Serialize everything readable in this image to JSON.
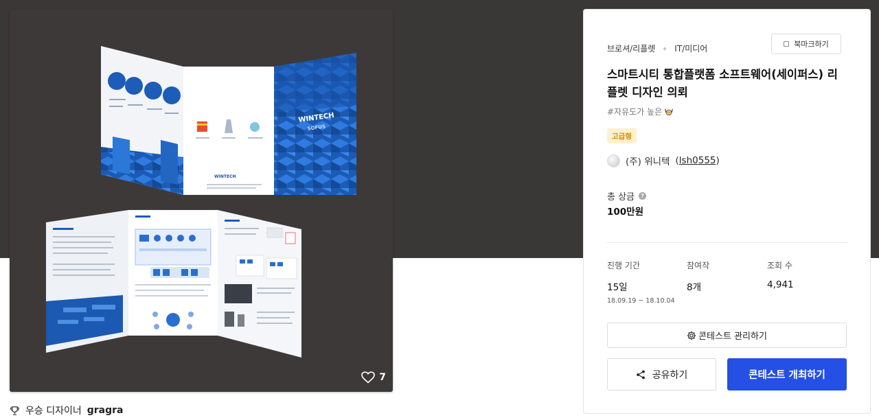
{
  "hero": {
    "likes": "7",
    "brochure_brand": "WINTECH",
    "brochure_sub": "SOFUS",
    "brochure_footer": "WINTECH"
  },
  "winner": {
    "prefix": "우승 디자이너",
    "name": "gragra"
  },
  "contest": {
    "category_1": "브로셔/리플렛",
    "category_2": "IT/미디어",
    "bookmark_label": "북마크하기",
    "title": "스마트시티 통합플랫폼 소프트웨어(세이퍼스) 리플렛 디자인 의뢰",
    "hashtag": "#자유도가 높은",
    "grade_badge": "고급형",
    "host_name": "(주) 위니텍",
    "host_id": "lsh0555",
    "host_id_paren_open": "(",
    "host_id_paren_close": ")"
  },
  "prize": {
    "label": "총 상금",
    "help": "?",
    "value": "100만원"
  },
  "stats": {
    "period_label": "진행 기간",
    "period_value": "15일",
    "period_range": "18.09.19 ~ 18.10.04",
    "entries_label": "참여작",
    "entries_value": "8개",
    "views_label": "조회 수",
    "views_value": "4,941"
  },
  "actions": {
    "manage_label": "콘테스트 관리하기",
    "share_label": "공유하기",
    "host_label": "콘테스트 개최하기"
  },
  "colors": {
    "primary": "#2450e6",
    "dark_band": "#3a3737",
    "grade_bg": "#fff1cc",
    "grade_fg": "#d98c00",
    "brochure_blue": "#1f5fb8"
  },
  "icons": {
    "heart": "heart-icon",
    "trophy": "trophy-icon",
    "gear": "gear-icon",
    "share": "share-icon",
    "bookmark": "bookmark-icon"
  }
}
